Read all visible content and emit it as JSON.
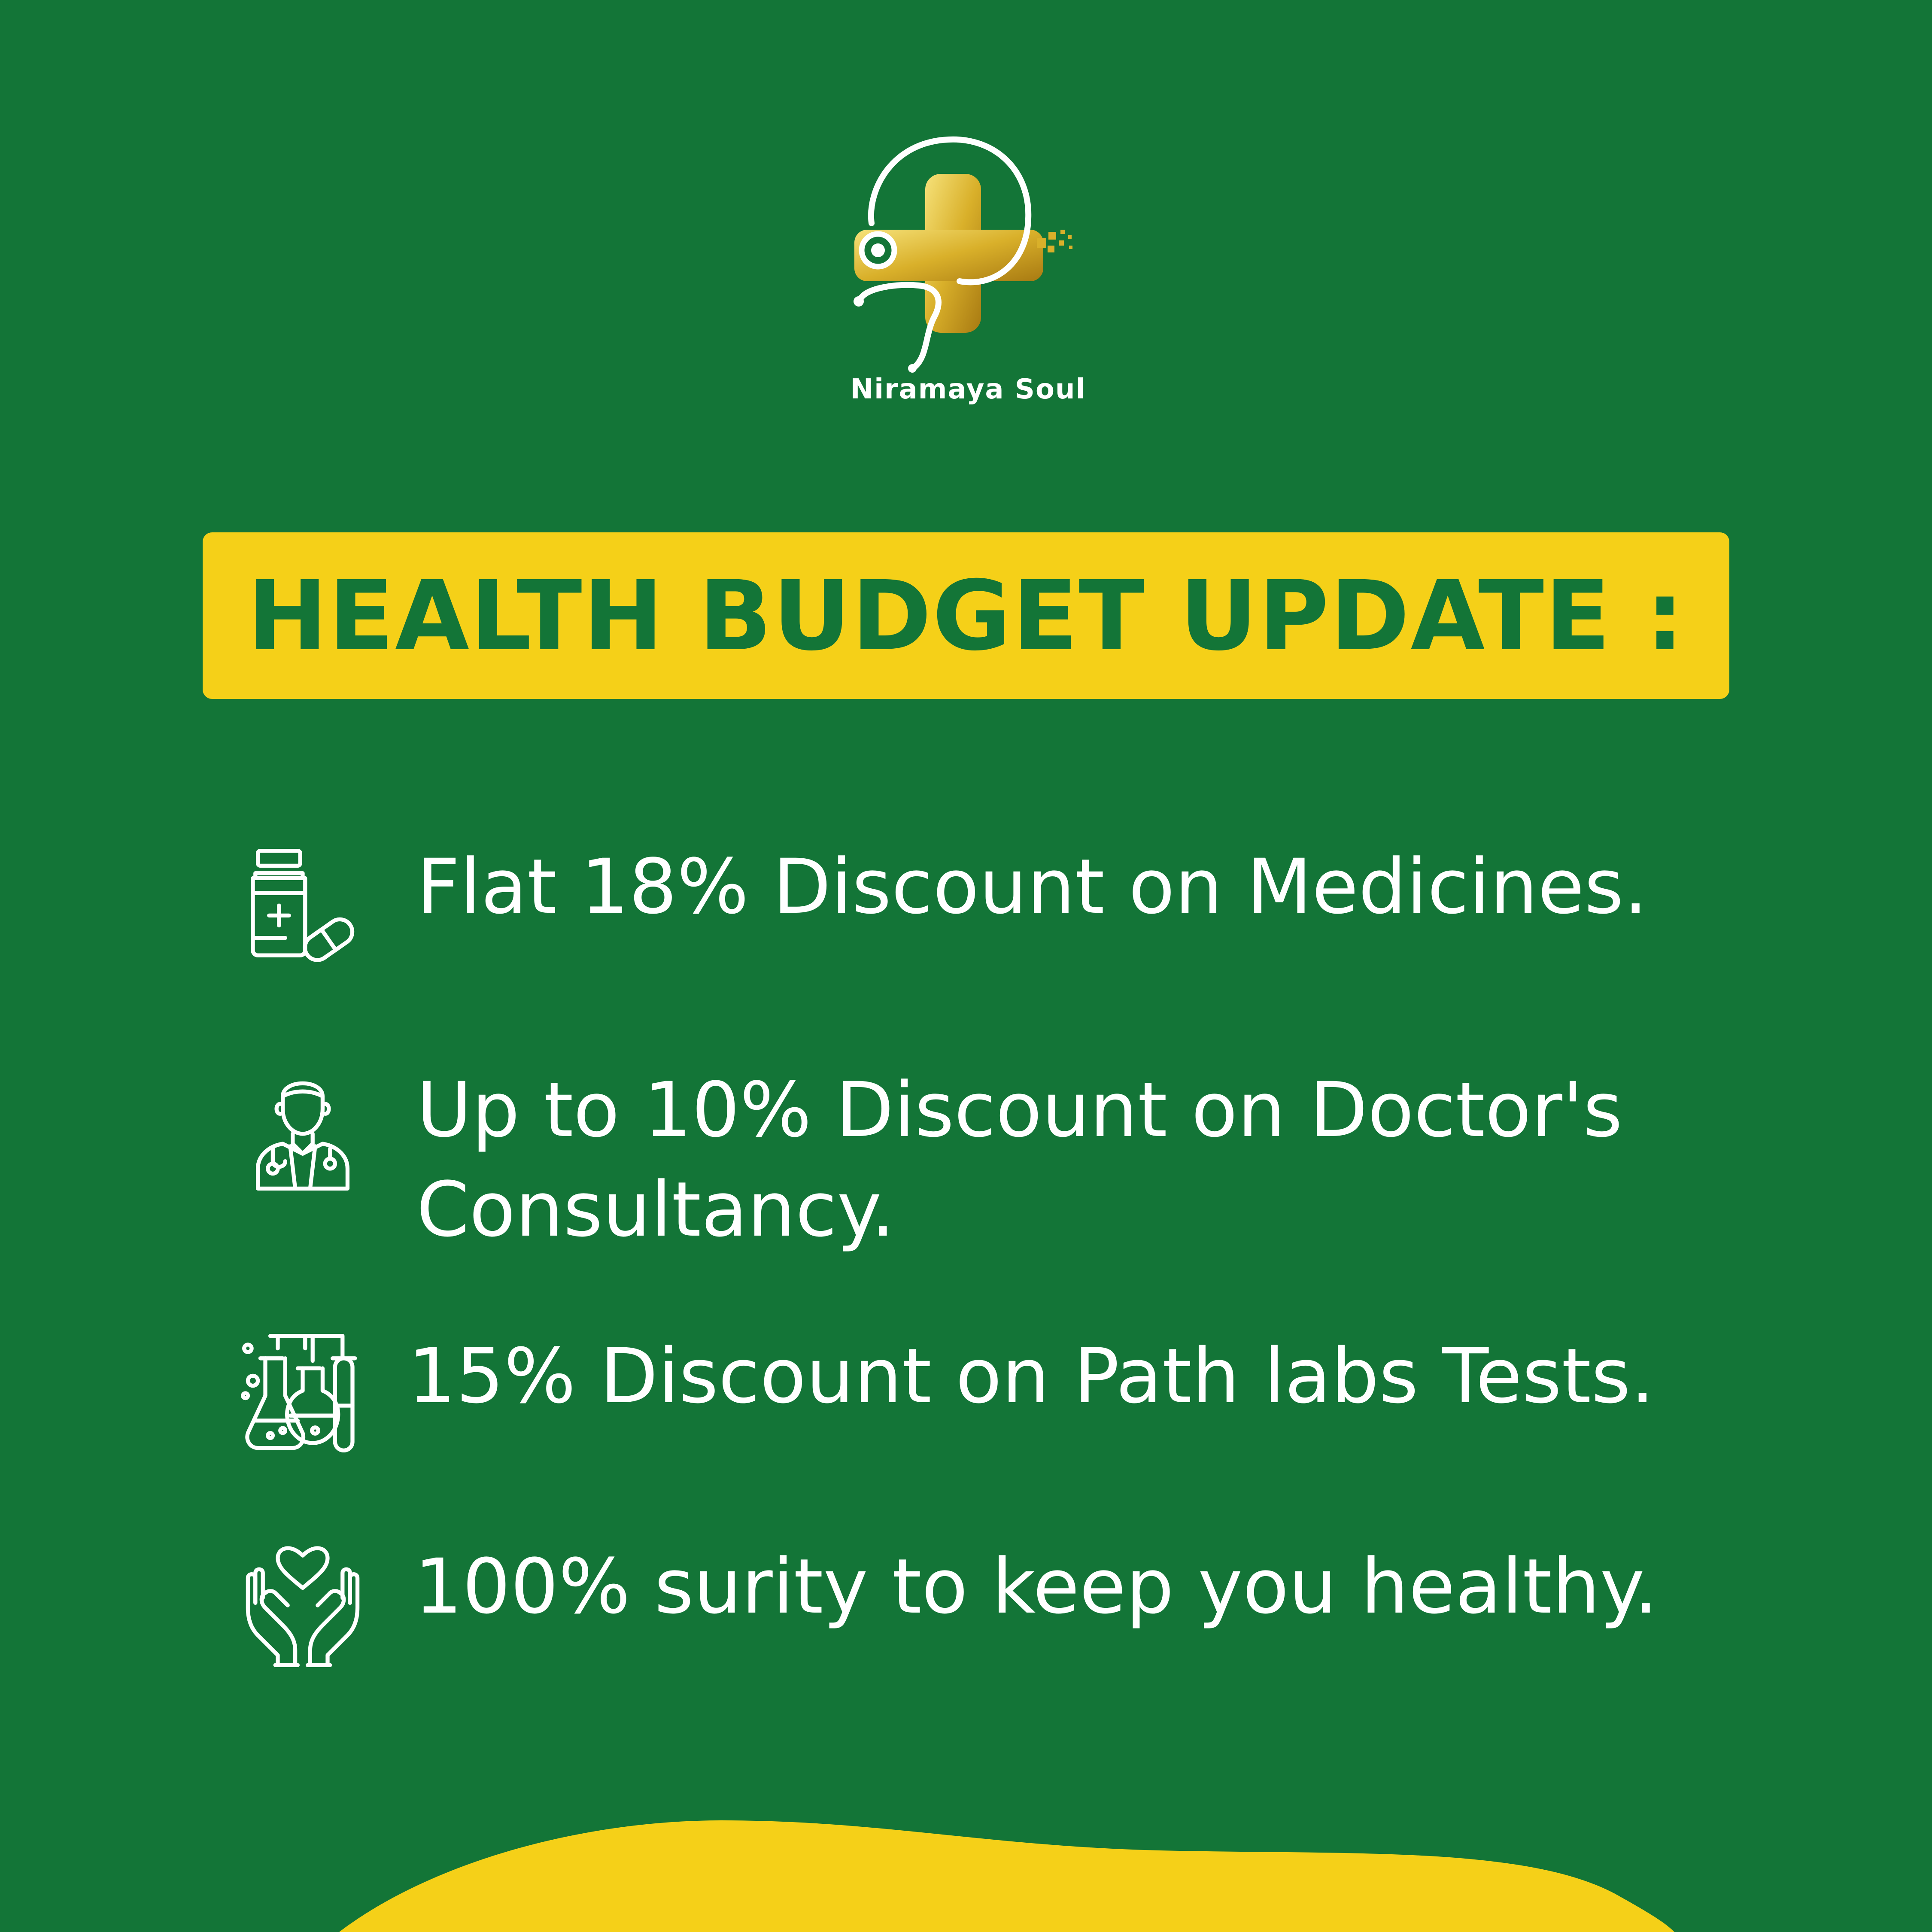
{
  "colors": {
    "background": "#137537",
    "accent_yellow": "#f5d018",
    "text_white": "#ffffff",
    "logo_gold": "#d9b02a"
  },
  "brand": {
    "name": "Niramaya Soul",
    "logo_icon": "stethoscope-cross-logo"
  },
  "banner": {
    "title": "HEALTH BUDGET UPDATE :"
  },
  "benefits": [
    {
      "icon": "medicine-bottle-pill-icon",
      "text_lines": [
        "Flat 18% Discount on Medicines."
      ]
    },
    {
      "icon": "doctor-icon",
      "text_lines": [
        "Up to 10% Discount on Doctor's",
        "Consultancy."
      ]
    },
    {
      "icon": "lab-flasks-icon",
      "text_lines": [
        "15% Discount on Path labs Tests."
      ]
    },
    {
      "icon": "hands-heart-icon",
      "text_lines": [
        "100% surity to keep you healthy."
      ]
    }
  ]
}
